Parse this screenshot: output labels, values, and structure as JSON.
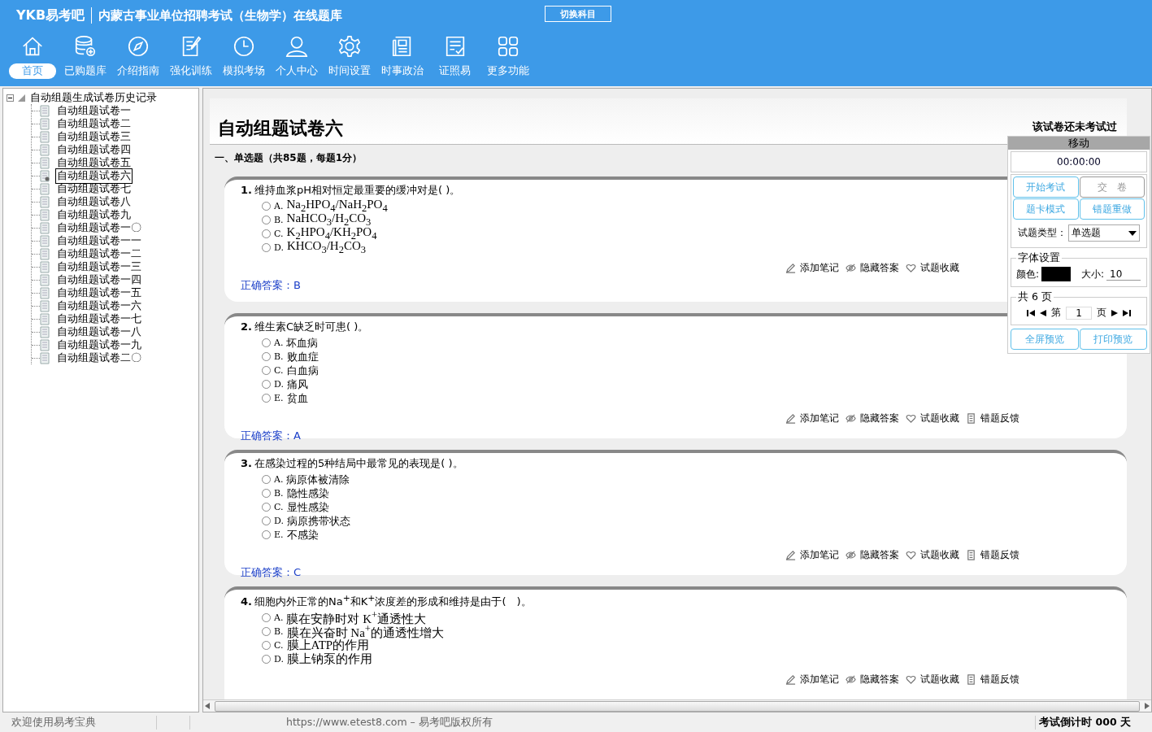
{
  "header": {
    "logo": "YKB易考吧",
    "title": "内蒙古事业单位招聘考试（生物学）在线题库",
    "switch_button": "切换科目"
  },
  "nav": [
    {
      "label": "首页",
      "selected": true
    },
    {
      "label": "已购题库",
      "selected": false
    },
    {
      "label": "介绍指南",
      "selected": false
    },
    {
      "label": "强化训练",
      "selected": false
    },
    {
      "label": "模拟考场",
      "selected": false
    },
    {
      "label": "个人中心",
      "selected": false
    },
    {
      "label": "时间设置",
      "selected": false
    },
    {
      "label": "时事政治",
      "selected": false
    },
    {
      "label": "证照易",
      "selected": false
    },
    {
      "label": "更多功能",
      "selected": false
    }
  ],
  "tree": {
    "label": "自动组题生成试卷历史记录",
    "expanded": true,
    "children": [
      {
        "label": "自动组题试卷一",
        "selected": false
      },
      {
        "label": "自动组题试卷二",
        "selected": false
      },
      {
        "label": "自动组题试卷三",
        "selected": false
      },
      {
        "label": "自动组题试卷四",
        "selected": false
      },
      {
        "label": "自动组题试卷五",
        "selected": false
      },
      {
        "label": "自动组题试卷六",
        "selected": true
      },
      {
        "label": "自动组题试卷七",
        "selected": false
      },
      {
        "label": "自动组题试卷八",
        "selected": false
      },
      {
        "label": "自动组题试卷九",
        "selected": false
      },
      {
        "label": "自动组题试卷一〇",
        "selected": false
      },
      {
        "label": "自动组题试卷一一",
        "selected": false
      },
      {
        "label": "自动组题试卷一二",
        "selected": false
      },
      {
        "label": "自动组题试卷一三",
        "selected": false
      },
      {
        "label": "自动组题试卷一四",
        "selected": false
      },
      {
        "label": "自动组题试卷一五",
        "selected": false
      },
      {
        "label": "自动组题试卷一六",
        "selected": false
      },
      {
        "label": "自动组题试卷一七",
        "selected": false
      },
      {
        "label": "自动组题试卷一八",
        "selected": false
      },
      {
        "label": "自动组题试卷一九",
        "selected": false
      },
      {
        "label": "自动组题试卷二〇",
        "selected": false
      }
    ]
  },
  "paper": {
    "title": "自动组题试卷六",
    "status": "该试卷还未考试过",
    "section": "一、单选题（共85题，每题1分）"
  },
  "questions": [
    {
      "number": "1.",
      "text": "维持血浆pH相对恒定最重要的缓冲对是( )。",
      "options": [
        {
          "letter": "A.",
          "text": "Na$_{2}$HPO$_{4}$/NaH$_{2}$PO$_{4}$",
          "selected": false
        },
        {
          "letter": "B.",
          "text": "NaHCO$_{3}$/H$_{2}$CO$_{3}$",
          "selected": false
        },
        {
          "letter": "C.",
          "text": "K$_{2}$HPO$_{4}$/KH$_{2}$PO$_{4}$",
          "selected": false
        },
        {
          "letter": "D.",
          "text": "KHCO$_{3}$/H$_{2}$CO$_{3}$",
          "selected": false
        }
      ],
      "actions": [
        "添加笔记",
        "隐藏答案",
        "试题收藏"
      ],
      "answer": "正确答案：B"
    },
    {
      "number": "2.",
      "text": "维生素C缺乏时可患( )。",
      "options": [
        {
          "letter": "A.",
          "text": "坏血病",
          "selected": false
        },
        {
          "letter": "B.",
          "text": "败血症",
          "selected": false
        },
        {
          "letter": "C.",
          "text": "白血病",
          "selected": false
        },
        {
          "letter": "D.",
          "text": "痛风",
          "selected": false
        },
        {
          "letter": "E.",
          "text": "贫血",
          "selected": false
        }
      ],
      "actions": [
        "添加笔记",
        "隐藏答案",
        "试题收藏",
        "错题反馈"
      ],
      "answer": "正确答案：A"
    },
    {
      "number": "3.",
      "text": "在感染过程的5种结局中最常见的表现是( )。",
      "options": [
        {
          "letter": "A.",
          "text": "病原体被清除",
          "selected": false
        },
        {
          "letter": "B.",
          "text": "隐性感染",
          "selected": false
        },
        {
          "letter": "C.",
          "text": "显性感染",
          "selected": false
        },
        {
          "letter": "D.",
          "text": "病原携带状态",
          "selected": false
        },
        {
          "letter": "E.",
          "text": "不感染",
          "selected": false
        }
      ],
      "actions": [
        "添加笔记",
        "隐藏答案",
        "试题收藏",
        "错题反馈"
      ],
      "answer": "正确答案：C"
    },
    {
      "number": "4.",
      "text": "细胞内外正常的Na$^{+}$和K$^{+}$浓度差的形成和维持是由于(　)。",
      "options": [
        {
          "letter": "A.",
          "text": "膜在安静时对 K$^{+}$通透性大",
          "selected": false
        },
        {
          "letter": "B.",
          "text": "膜在兴奋时 Na$^{+}$的通透性增大",
          "selected": false
        },
        {
          "letter": "C.",
          "text": "膜上ATP的作用",
          "selected": false
        },
        {
          "letter": "D.",
          "text": "膜上钠泵的作用",
          "selected": false
        }
      ],
      "actions": [
        "添加笔记",
        "隐藏答案",
        "试题收藏",
        "错题反馈"
      ]
    }
  ],
  "panel": {
    "title": "移动",
    "timer": "00:00:00",
    "buttons": [
      {
        "label": "开始考试",
        "disabled": false
      },
      {
        "label": "交　卷",
        "disabled": true
      },
      {
        "label": "题卡模式",
        "disabled": false
      },
      {
        "label": "错题重做",
        "disabled": false
      }
    ],
    "type_label": "试题类型：",
    "type_value": "单选题",
    "font_group": "字体设置",
    "color_label": "颜色:",
    "color": "#000000",
    "size_label": "大小:",
    "size_value": "10",
    "page_group": "共 6 页",
    "page_prefix": "第",
    "page_value": "1",
    "page_suffix": "页",
    "bottom_buttons": [
      "全屏预览",
      "打印预览"
    ]
  },
  "status_bar": {
    "welcome": "欢迎使用易考宝典",
    "copyright": "https://www.etest8.com – 易考吧版权所有",
    "countdown": "考试倒计时 000 天"
  }
}
